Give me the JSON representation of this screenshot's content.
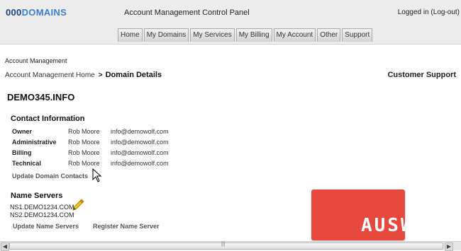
{
  "header": {
    "logo_part1": "000",
    "logo_part2": "DOMAINS",
    "panel_title": "Account Management Control Panel",
    "logged_in_label": "Logged in",
    "logout_label": "(Log-out)"
  },
  "nav": {
    "tabs": [
      {
        "label": "Home"
      },
      {
        "label": "My Domains"
      },
      {
        "label": "My Services"
      },
      {
        "label": "My Billing"
      },
      {
        "label": "My Account"
      },
      {
        "label": "Other"
      },
      {
        "label": "Support"
      }
    ]
  },
  "page": {
    "section_label": "Account Management",
    "breadcrumb_home": "Account Management Home",
    "breadcrumb_sep": ">",
    "breadcrumb_current": "Domain Details",
    "support_label": "Customer Support",
    "domain_name": "DEMO345.INFO"
  },
  "contacts": {
    "title": "Contact Information",
    "rows": [
      {
        "role": "Owner",
        "name": "Rob Moore",
        "email": "info@demowolf.com"
      },
      {
        "role": "Administrative",
        "name": "Rob Moore",
        "email": "info@demowolf.com"
      },
      {
        "role": "Billing",
        "name": "Rob Moore",
        "email": "info@demowolf.com"
      },
      {
        "role": "Technical",
        "name": "Rob Moore",
        "email": "info@demowolf.com"
      }
    ],
    "update_link": "Update Domain Contacts"
  },
  "nameservers": {
    "title": "Name Servers",
    "servers": [
      "NS1.DEMO1234.COM",
      "NS2.DEMO1234.COM"
    ],
    "update_link": "Update Name Servers",
    "register_link": "Register Name Server"
  },
  "watermark": {
    "text": "AUSWEB"
  },
  "scrollbar": {
    "left_arrow": "◀",
    "right_arrow": "▶",
    "grip": "|||"
  },
  "colors": {
    "logo_dark": "#1a3f8a",
    "logo_light": "#3b7fd0",
    "watermark_bg": "#e8493f"
  }
}
